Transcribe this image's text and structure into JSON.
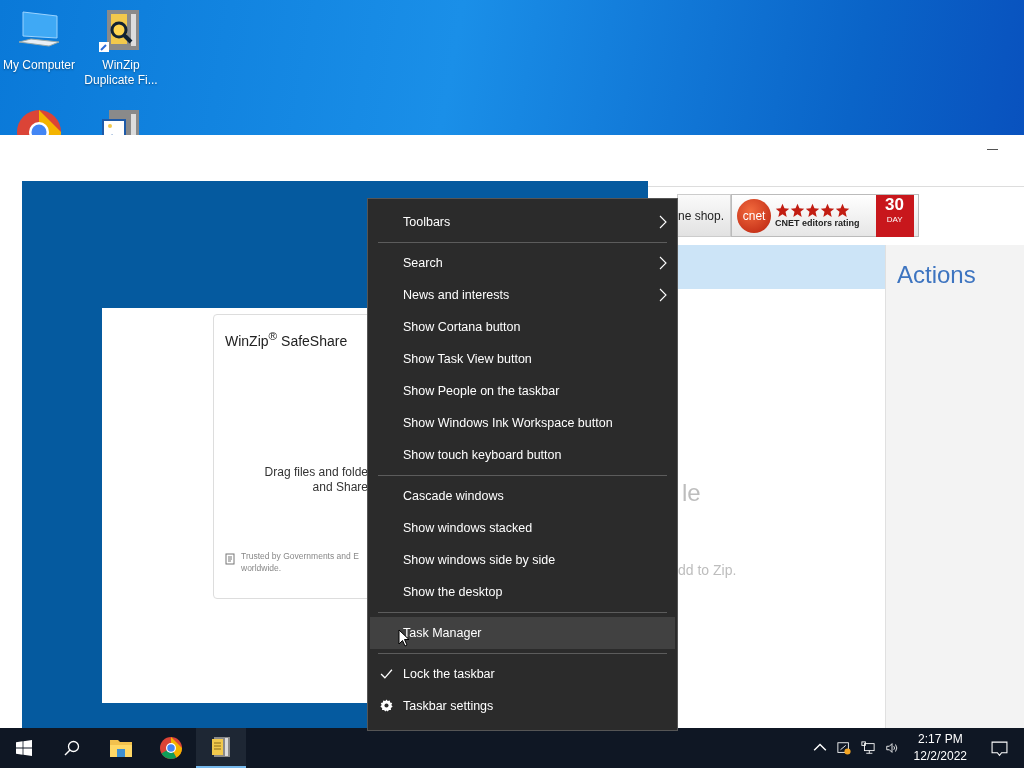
{
  "desktop_icons": [
    {
      "kind": "computer",
      "label": "My Computer"
    },
    {
      "kind": "finder",
      "label": "WinZip Duplicate Fi..."
    },
    {
      "kind": "chrome"
    },
    {
      "kind": "image-zip"
    }
  ],
  "back_window": {
    "ad_text": "ne shop.",
    "badge": {
      "logo": "cnet",
      "stars": 5,
      "rating_label": "CNET editors rating",
      "days": "30",
      "day_label": "DAY"
    },
    "actions_title": "Actions",
    "faded_texts": [
      "le",
      "dd to Zip."
    ]
  },
  "safeshare": {
    "title": "WinZip$^{®}$ SafeShare",
    "drop_lines": [
      "Drag files and folde",
      "and Share"
    ],
    "trust_lines": [
      "Trusted by Governments and E",
      "worldwide."
    ]
  },
  "context_menu": {
    "groups": [
      [
        {
          "label": "Toolbars",
          "kind": "submenu",
          "selected": false,
          "checked": false
        }
      ],
      [
        {
          "label": "Search",
          "kind": "submenu",
          "selected": false,
          "checked": false
        },
        {
          "label": "News and interests",
          "kind": "submenu",
          "selected": false,
          "checked": false
        },
        {
          "label": "Show Cortana button",
          "kind": "command",
          "selected": false,
          "checked": false
        },
        {
          "label": "Show Task View button",
          "kind": "command",
          "selected": false,
          "checked": false
        },
        {
          "label": "Show People on the taskbar",
          "kind": "command",
          "selected": false,
          "checked": false
        },
        {
          "label": "Show Windows Ink Workspace button",
          "kind": "command",
          "selected": false,
          "checked": false
        },
        {
          "label": "Show touch keyboard button",
          "kind": "command",
          "selected": false,
          "checked": false
        }
      ],
      [
        {
          "label": "Cascade windows",
          "kind": "command",
          "selected": false,
          "checked": false
        },
        {
          "label": "Show windows stacked",
          "kind": "command",
          "selected": false,
          "checked": false
        },
        {
          "label": "Show windows side by side",
          "kind": "command",
          "selected": false,
          "checked": false
        },
        {
          "label": "Show the desktop",
          "kind": "command",
          "selected": false,
          "checked": false
        }
      ],
      [
        {
          "label": "Task Manager",
          "kind": "command",
          "selected": true,
          "checked": false
        }
      ],
      [
        {
          "label": "Lock the taskbar",
          "kind": "command",
          "selected": false,
          "checked": true
        },
        {
          "label": "Taskbar settings",
          "kind": "settings",
          "selected": false,
          "checked": false
        }
      ]
    ]
  },
  "taskbar": {
    "apps": [
      {
        "kind": "explorer",
        "active": false
      },
      {
        "kind": "chrome",
        "active": false
      },
      {
        "kind": "winzip",
        "active": true
      }
    ],
    "time": "2:17 PM",
    "date": "12/2/2022"
  }
}
